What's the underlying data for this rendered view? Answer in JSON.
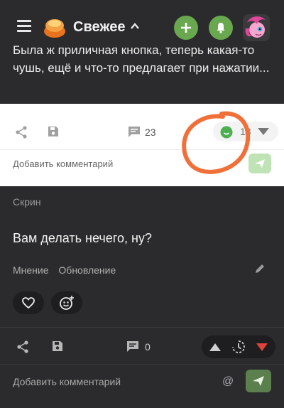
{
  "header": {
    "feed_title": "Свежее"
  },
  "post_top": {
    "text": "Была ж приличная кнопка, теперь какая-то чушь, ещё и что-то предлагает при нажатии...",
    "comments_count": "23",
    "rating": "13",
    "comment_placeholder": "Добавить комментарий"
  },
  "post_bottom": {
    "section": "Скрин",
    "title": "Вам делать нечего, ну?",
    "tags": [
      "Мнение",
      "Обновление"
    ],
    "comments_count": "0",
    "comment_placeholder": "Добавить комментарий",
    "at_symbol": "@"
  },
  "colors": {
    "accent_green": "#6aa84f",
    "vote_down_red": "#e0413b",
    "annotation_orange": "#f0703a"
  }
}
